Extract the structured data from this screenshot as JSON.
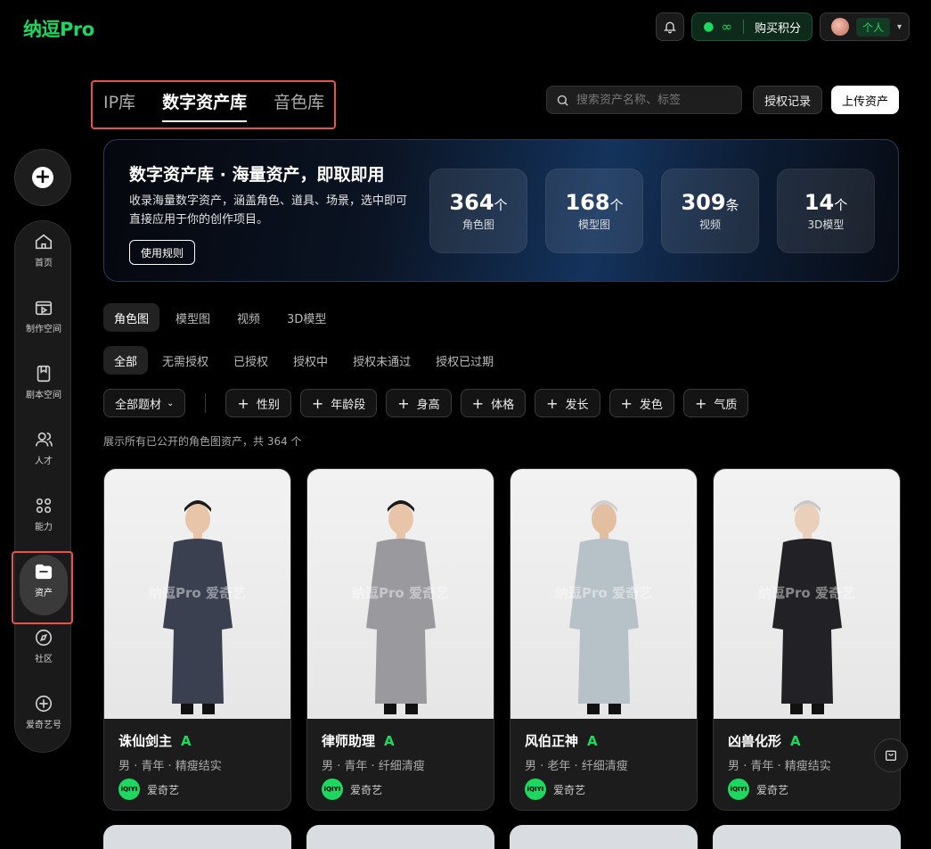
{
  "app": {
    "logo": "纳逗Pro"
  },
  "header": {
    "points_value": "∞",
    "buy_points": "购买积分",
    "account_type": "个人"
  },
  "sidebar": {
    "items": [
      {
        "label": "首页",
        "icon": "home-icon"
      },
      {
        "label": "制作空间",
        "icon": "video-edit-icon"
      },
      {
        "label": "剧本空间",
        "icon": "book-icon"
      },
      {
        "label": "人才",
        "icon": "people-icon"
      },
      {
        "label": "能力",
        "icon": "grid-icon"
      },
      {
        "label": "资产",
        "icon": "folder-icon",
        "active": true
      },
      {
        "label": "社区",
        "icon": "compass-icon"
      },
      {
        "label": "爱奇艺号",
        "icon": "plus-circle-icon"
      }
    ]
  },
  "library_tabs": {
    "ip": "IP库",
    "digital": "数字资产库",
    "sound": "音色库",
    "active": "数字资产库"
  },
  "search": {
    "placeholder": "搜索资产名称、标签"
  },
  "toolbar": {
    "auth_records": "授权记录",
    "upload": "上传资产"
  },
  "banner": {
    "title": "数字资产库 · 海量资产，即取即用",
    "desc": "收录海量数字资产，涵盖角色、道具、场景，选中即可直接应用于你的创作项目。",
    "rules_button": "使用规则",
    "stats": [
      {
        "num": "364",
        "unit": "个",
        "label": "角色图"
      },
      {
        "num": "168",
        "unit": "个",
        "label": "模型图"
      },
      {
        "num": "309",
        "unit": "条",
        "label": "视频"
      },
      {
        "num": "14",
        "unit": "个",
        "label": "3D模型"
      }
    ]
  },
  "type_tabs": [
    "角色图",
    "模型图",
    "视频",
    "3D模型"
  ],
  "status_tabs": [
    "全部",
    "无需授权",
    "已授权",
    "授权中",
    "授权未通过",
    "授权已过期"
  ],
  "filters": {
    "theme": "全部题材",
    "tags": [
      "性别",
      "年龄段",
      "身高",
      "体格",
      "发长",
      "发色",
      "气质"
    ]
  },
  "summary": "展示所有已公开的角色图资产，共 364 个",
  "watermark": "纳逗Pro 爱奇艺",
  "cards": [
    {
      "name": "诛仙剑主",
      "grade": "A",
      "desc": "男 · 青年 · 精瘦结实",
      "owner": "爱奇艺",
      "robe": "#3b4050",
      "skin": "#e8c4a8",
      "hair": "#1a1a1a"
    },
    {
      "name": "律师助理",
      "grade": "A",
      "desc": "男 · 青年 · 纤细清瘦",
      "owner": "爱奇艺",
      "robe": "#9a9a9e",
      "skin": "#e8c4a8",
      "hair": "#1a1a1a"
    },
    {
      "name": "风伯正神",
      "grade": "A",
      "desc": "男 · 老年 · 纤细清瘦",
      "owner": "爱奇艺",
      "robe": "#b7c1c8",
      "skin": "#e3bfa2",
      "hair": "#d0d0d0"
    },
    {
      "name": "凶兽化形",
      "grade": "A",
      "desc": "男 · 青年 · 精瘦结实",
      "owner": "爱奇艺",
      "robe": "#222226",
      "skin": "#ead0ba",
      "hair": "#c9c9c9"
    }
  ],
  "badge_text": "iQIYI"
}
